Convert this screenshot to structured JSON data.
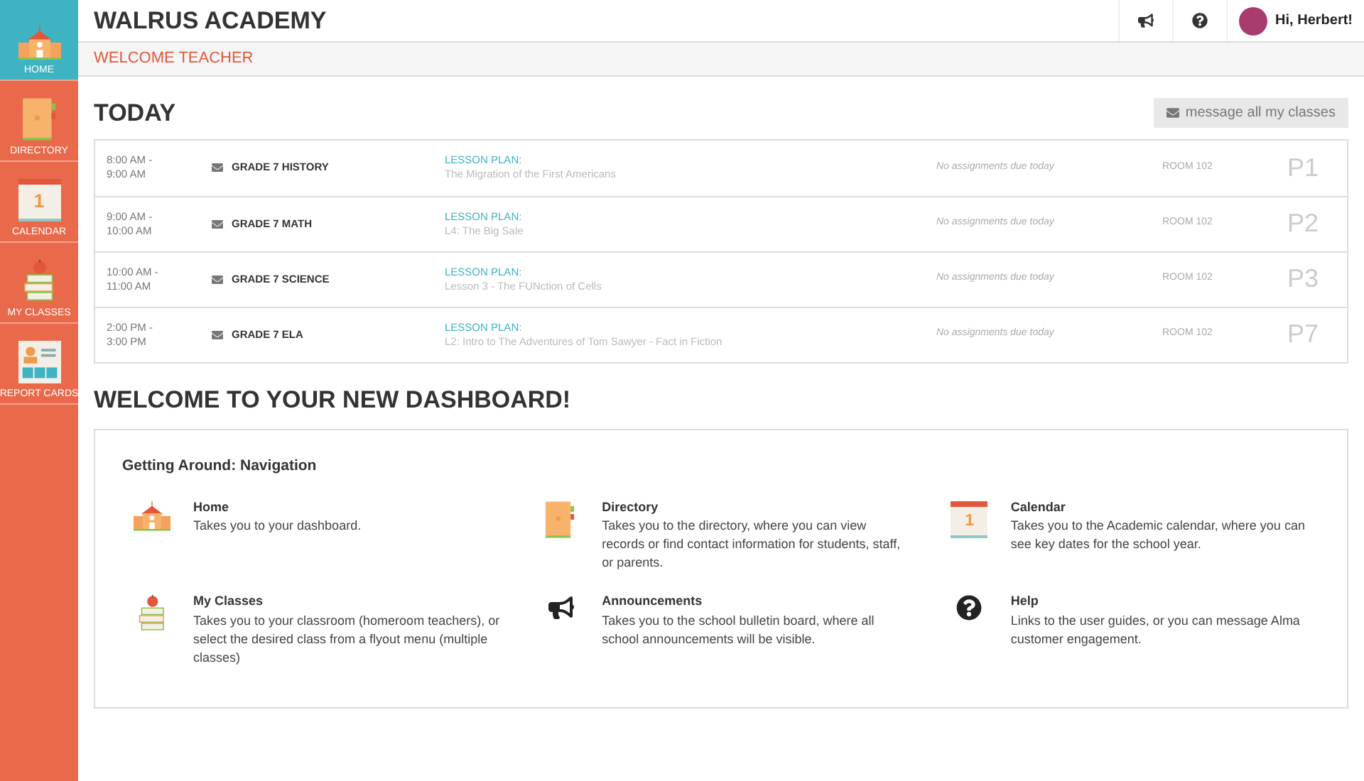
{
  "sidebar": {
    "items": [
      {
        "label": "HOME",
        "kind": "home",
        "selected": true
      },
      {
        "label": "DIRECTORY",
        "kind": "directory",
        "selected": false
      },
      {
        "label": "CALENDAR",
        "kind": "calendar",
        "selected": false,
        "day": "1"
      },
      {
        "label": "MY CLASSES",
        "kind": "classes",
        "selected": false
      },
      {
        "label": "REPORT CARDS",
        "kind": "report",
        "selected": false
      }
    ]
  },
  "header": {
    "title": "WALRUS ACADEMY",
    "greeting": "Hi, Herbert!"
  },
  "subheader": {
    "title": "WELCOME TEACHER"
  },
  "today": {
    "title": "TODAY",
    "button": "message all my classes",
    "rows": [
      {
        "start": "8:00 AM -",
        "end": "9:00 AM",
        "class": "GRADE 7 HISTORY",
        "plan_label": "LESSON PLAN:",
        "plan": "The Migration of the First Americans",
        "assignments": "No assignments due today",
        "room": "ROOM 102",
        "period": "P1"
      },
      {
        "start": "9:00 AM -",
        "end": "10:00 AM",
        "class": "GRADE 7 MATH",
        "plan_label": "LESSON PLAN:",
        "plan": "L4: The Big Sale",
        "assignments": "No assignments due today",
        "room": "ROOM 102",
        "period": "P2"
      },
      {
        "start": "10:00 AM -",
        "end": "11:00 AM",
        "class": "GRADE 7 SCIENCE",
        "plan_label": "LESSON PLAN:",
        "plan": "Lesson 3 - The FUNction of Cells",
        "assignments": "No assignments due today",
        "room": "ROOM 102",
        "period": "P3"
      },
      {
        "start": "2:00 PM -",
        "end": "3:00 PM",
        "class": "GRADE 7 ELA",
        "plan_label": "LESSON PLAN:",
        "plan": "L2: Intro to The Adventures of Tom Sawyer - Fact in Fiction",
        "assignments": "No assignments due today",
        "room": "ROOM 102",
        "period": "P7"
      }
    ]
  },
  "welcome": {
    "title": "WELCOME TO YOUR NEW DASHBOARD!",
    "section": "Getting Around: Navigation",
    "items": [
      {
        "kind": "home",
        "title": "Home",
        "text": "Takes you to your dashboard."
      },
      {
        "kind": "directory",
        "title": "Directory",
        "text": "Takes you to the directory, where you can view records or find contact information for students, staff, or parents."
      },
      {
        "kind": "calendar",
        "title": "Calendar",
        "text": "Takes you to the Academic calendar, where you can see key dates for the school year.",
        "day": "1"
      },
      {
        "kind": "classes",
        "title": "My Classes",
        "text": "Takes you to your classroom (homeroom teachers), or select the desired class from a flyout menu (multiple classes)"
      },
      {
        "kind": "announcements",
        "title": "Announcements",
        "text": "Takes you to the school bulletin board, where all school announcements will be visible."
      },
      {
        "kind": "help",
        "title": "Help",
        "text": "Links to the user guides, or you can message Alma customer engagement."
      }
    ]
  }
}
